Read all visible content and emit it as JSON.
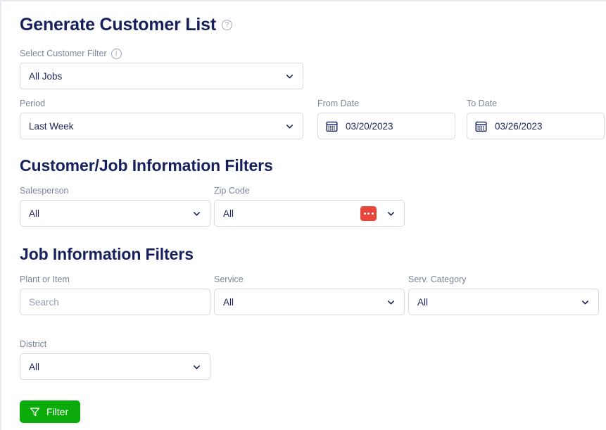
{
  "header": {
    "title": "Generate Customer List",
    "help_icon": "question-circle-icon"
  },
  "customer_filter": {
    "label": "Select Customer Filter",
    "info_icon": "info-circle-icon",
    "value": "All Jobs"
  },
  "period": {
    "label": "Period",
    "value": "Last Week"
  },
  "from_date": {
    "label": "From Date",
    "value": "03/20/2023",
    "icon": "calendar-icon"
  },
  "to_date": {
    "label": "To Date",
    "value": "03/26/2023",
    "icon": "calendar-icon"
  },
  "sections": {
    "customer_job": "Customer/Job Information Filters",
    "job_info": "Job Information Filters"
  },
  "salesperson": {
    "label": "Salesperson",
    "value": "All"
  },
  "zip_code": {
    "label": "Zip Code",
    "value": "All",
    "badge_icon": "ellipsis-icon"
  },
  "plant_or_item": {
    "label": "Plant or Item",
    "placeholder": "Search",
    "value": ""
  },
  "service": {
    "label": "Service",
    "value": "All"
  },
  "serv_category": {
    "label": "Serv. Category",
    "value": "All"
  },
  "district": {
    "label": "District",
    "value": "All"
  },
  "filter_button": {
    "label": "Filter",
    "icon": "funnel-icon"
  },
  "colors": {
    "title": "#16205c",
    "label": "#7b849b",
    "border": "#d5d9e6",
    "accent_green": "#0bab0b",
    "badge_red": "#e8463c",
    "text": "#1b2559"
  }
}
